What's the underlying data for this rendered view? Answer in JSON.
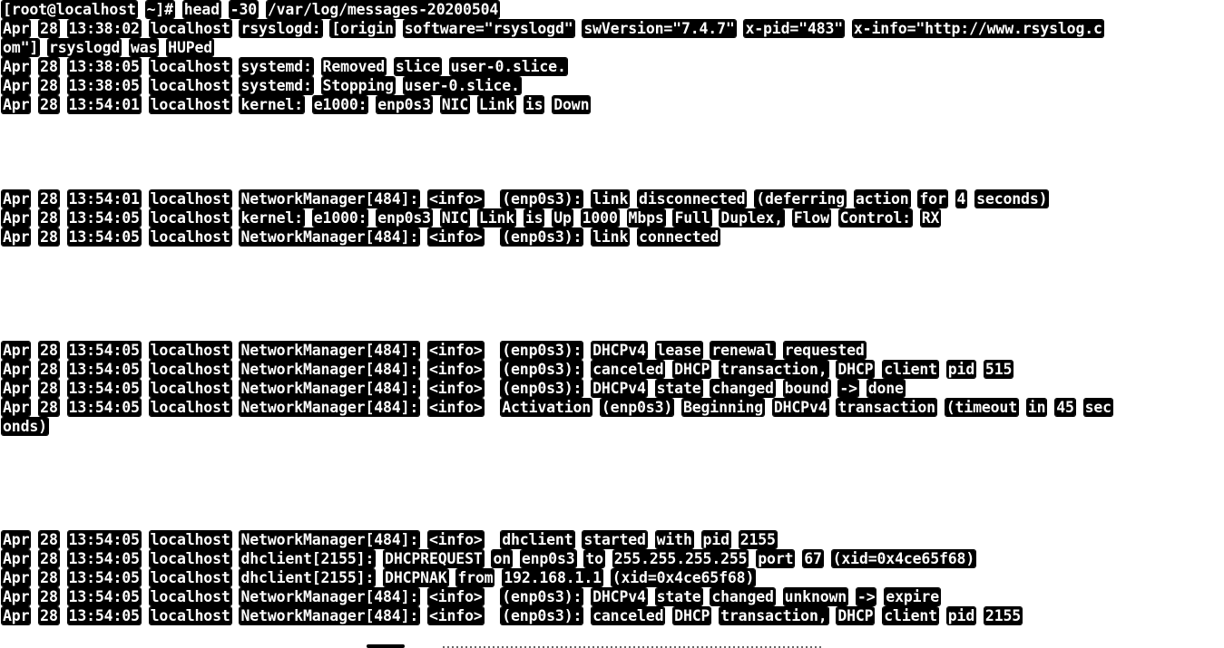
{
  "terminal": {
    "lines": [
      {
        "row": 0,
        "text": "[root@localhost ~]# head -30 /var/log/messages-20200504"
      },
      {
        "row": 1,
        "text": "Apr 28 13:38:02 localhost rsyslogd: [origin software=\"rsyslogd\" swVersion=\"7.4.7\" x-pid=\"483\" x-info=\"http://www.rsyslog.c"
      },
      {
        "row": 2,
        "text": "om\"] rsyslogd was HUPed"
      },
      {
        "row": 3,
        "text": "Apr 28 13:38:05 localhost systemd: Removed slice user-0.slice."
      },
      {
        "row": 4,
        "text": "Apr 28 13:38:05 localhost systemd: Stopping user-0.slice."
      },
      {
        "row": 5,
        "text": "Apr 28 13:54:01 localhost kernel: e1000: enp0s3 NIC Link is Down"
      },
      {
        "row": 10,
        "text": "Apr 28 13:54:01 localhost NetworkManager[484]: <info>  (enp0s3): link disconnected (deferring action for 4 seconds)"
      },
      {
        "row": 11,
        "text": "Apr 28 13:54:05 localhost kernel: e1000: enp0s3 NIC Link is Up 1000 Mbps Full Duplex, Flow Control: RX"
      },
      {
        "row": 12,
        "text": "Apr 28 13:54:05 localhost NetworkManager[484]: <info>  (enp0s3): link connected"
      },
      {
        "row": 18,
        "text": "Apr 28 13:54:05 localhost NetworkManager[484]: <info>  (enp0s3): DHCPv4 lease renewal requested"
      },
      {
        "row": 19,
        "text": "Apr 28 13:54:05 localhost NetworkManager[484]: <info>  (enp0s3): canceled DHCP transaction, DHCP client pid 515"
      },
      {
        "row": 20,
        "text": "Apr 28 13:54:05 localhost NetworkManager[484]: <info>  (enp0s3): DHCPv4 state changed bound -> done"
      },
      {
        "row": 21,
        "text": "Apr 28 13:54:05 localhost NetworkManager[484]: <info>  Activation (enp0s3) Beginning DHCPv4 transaction (timeout in 45 sec"
      },
      {
        "row": 22,
        "text": "onds)"
      },
      {
        "row": 28,
        "text": "Apr 28 13:54:05 localhost NetworkManager[484]: <info>  dhclient started with pid 2155"
      },
      {
        "row": 29,
        "text": "Apr 28 13:54:05 localhost dhclient[2155]: DHCPREQUEST on enp0s3 to 255.255.255.255 port 67 (xid=0x4ce65f68)"
      },
      {
        "row": 30,
        "text": "Apr 28 13:54:05 localhost dhclient[2155]: DHCPNAK from 192.168.1.1 (xid=0x4ce65f68)"
      },
      {
        "row": 31,
        "text": "Apr 28 13:54:05 localhost NetworkManager[484]: <info>  (enp0s3): DHCPv4 state changed unknown -> expire"
      },
      {
        "row": 32,
        "text": "Apr 28 13:54:05 localhost NetworkManager[484]: <info>  (enp0s3): canceled DHCP transaction, DHCP client pid 2155"
      }
    ]
  },
  "colors": {
    "background": "#ffffff",
    "text_highlight": "#000000",
    "text": "#ffffff"
  }
}
